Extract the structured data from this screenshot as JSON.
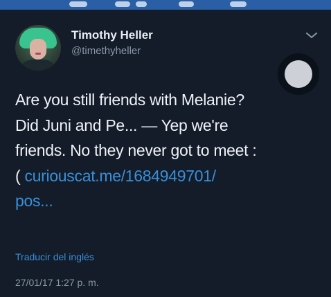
{
  "tweet": {
    "author_name": "Timothy Heller",
    "handle": "@timethyheller",
    "text_lines": [
      "Are you still friends with Melanie?",
      "Did Juni and Pe... — Yep we're",
      "friends. No they never got to meet :"
    ],
    "text_line4_prefix": "( ",
    "link_part1": "curiouscat.me/1684949701/",
    "link_part2": "pos...",
    "translate_label": "Traducir del inglés",
    "timestamp": "27/01/17 1:27 p. m."
  },
  "icons": {
    "menu": "chevron-down-icon",
    "avatar": "avatar",
    "overlay": "floating-button-dot"
  },
  "colors": {
    "background": "#131c28",
    "text_primary": "#eef2f7",
    "text_secondary": "#8a98a8",
    "link": "#3a8fd9",
    "top_bar": "#2a5fa5"
  }
}
